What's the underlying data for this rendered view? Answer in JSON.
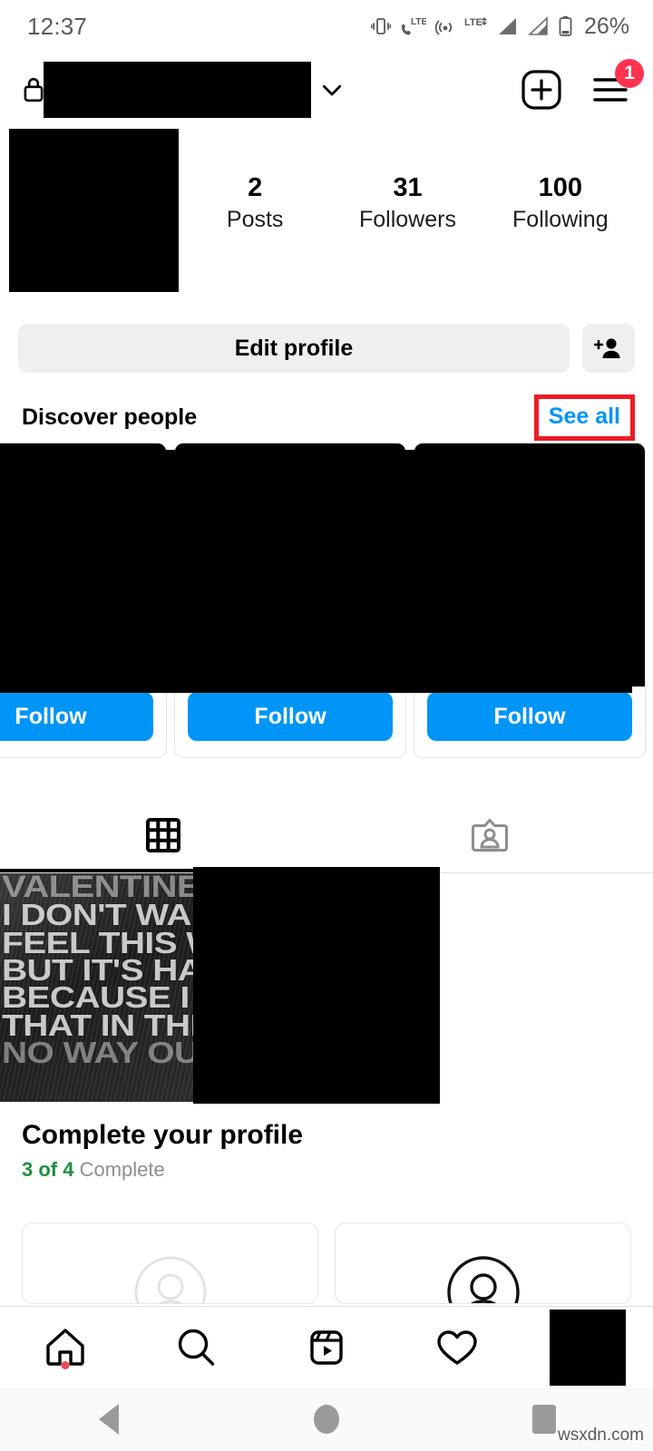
{
  "status_bar": {
    "time": "12:37",
    "battery_percent": "26%",
    "icons": [
      "vibrate-icon",
      "volte-call-icon",
      "hotspot-icon",
      "lte-plus-icon",
      "signal-bars-icon",
      "signal-bars-2-icon",
      "battery-icon"
    ]
  },
  "header": {
    "lock_icon": "lock-icon",
    "username": "",
    "username_redacted": true,
    "chevron_icon": "chevron-down-icon",
    "create_icon": "plus-square-icon",
    "menu_icon": "hamburger-menu-icon",
    "menu_badge": "1"
  },
  "profile": {
    "avatar_redacted": true,
    "stats": [
      {
        "value": "2",
        "label": "Posts"
      },
      {
        "value": "31",
        "label": "Followers"
      },
      {
        "value": "100",
        "label": "Following"
      }
    ],
    "edit_profile_label": "Edit profile",
    "add_person_icon": "add-person-icon"
  },
  "discover": {
    "title": "Discover people",
    "see_all_label": "See all",
    "see_all_highlight_color": "#ED1C24",
    "cards": [
      {
        "follow_label": "Follow",
        "redacted": true
      },
      {
        "follow_label": "Follow",
        "redacted": true
      },
      {
        "follow_label": "Follow",
        "redacted": true
      }
    ]
  },
  "tabs": [
    {
      "name": "grid-tab",
      "icon": "grid-icon",
      "active": true
    },
    {
      "name": "tagged-tab",
      "icon": "tagged-person-icon",
      "active": false
    }
  ],
  "posts": {
    "quote_lines": [
      "VALENTINE",
      "I DON'T WANT T",
      "FEEL THIS WAY",
      "BUT IT'S HARD",
      "BECAUSE I KNOW",
      "THAT IN THE END THERE",
      "NO WAY OUT"
    ],
    "second_post_redacted": true,
    "third_post_empty": true
  },
  "complete_profile": {
    "title": "Complete your profile",
    "progress_count": "3 of 4",
    "progress_word": "Complete",
    "progress_color": "#1E8E3E",
    "cards": [
      {
        "icon": "avatar-placeholder-icon",
        "style": "light"
      },
      {
        "icon": "avatar-outline-icon",
        "style": "dark"
      }
    ]
  },
  "bottom_nav": [
    {
      "name": "nav-home",
      "icon": "home-icon",
      "has_dot": true
    },
    {
      "name": "nav-search",
      "icon": "search-icon",
      "has_dot": false
    },
    {
      "name": "nav-reels",
      "icon": "reels-icon",
      "has_dot": false
    },
    {
      "name": "nav-activity",
      "icon": "heart-icon",
      "has_dot": false
    },
    {
      "name": "nav-profile",
      "icon": "profile-avatar-icon",
      "has_dot": false,
      "redacted": true
    }
  ],
  "system_nav": [
    {
      "name": "system-back-button",
      "icon": "triangle-back-icon"
    },
    {
      "name": "system-home-button",
      "icon": "circle-home-icon"
    },
    {
      "name": "system-recents-button",
      "icon": "square-recents-icon"
    }
  ],
  "watermark": "wsxdn.com",
  "colors": {
    "accent_blue": "#0095F6",
    "badge_red": "#FF3250",
    "highlight_red": "#ED1C24",
    "green": "#1E8E3E",
    "grey_button": "#efefef"
  }
}
